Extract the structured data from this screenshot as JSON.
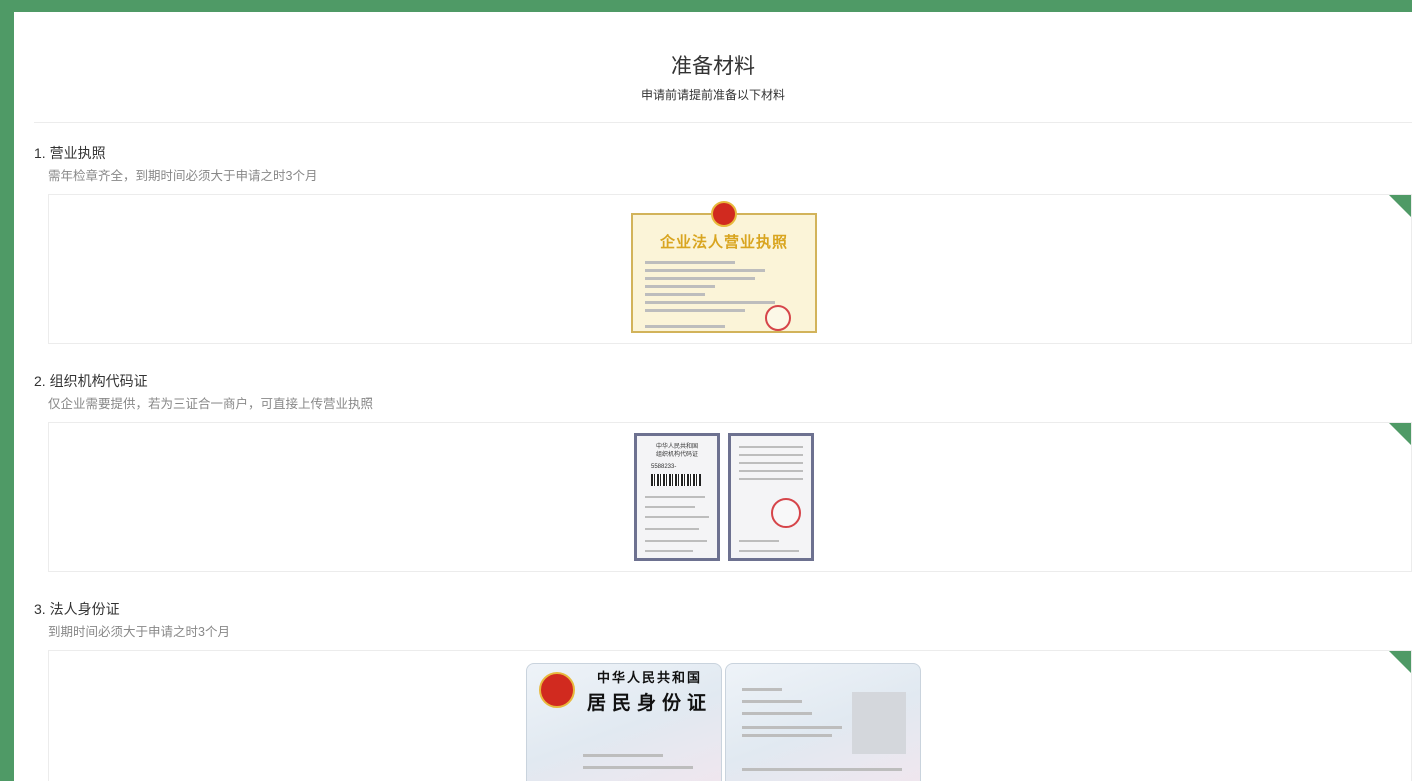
{
  "header": {
    "title": "准备材料",
    "subtitle": "申请前请提前准备以下材料"
  },
  "sections": [
    {
      "title": "1. 营业执照",
      "desc": "需年检章齐全，到期时间必须大于申请之时3个月",
      "image": {
        "title": "企业法人营业执照",
        "icon": "business-license-image"
      }
    },
    {
      "title": "2. 组织机构代码证",
      "desc": "仅企业需要提供，若为三证合一商户，可直接上传营业执照",
      "image": {
        "header_line1": "中华人民共和国",
        "header_line2": "组织机构代码证",
        "code": "5588233-",
        "icon": "organization-code-certificate-image"
      }
    },
    {
      "title": "3. 法人身份证",
      "desc": "到期时间必须大于申请之时3个月",
      "image": {
        "top_text": "中华人民共和国",
        "main_text": "居民身份证",
        "icon": "id-card-image"
      }
    }
  ],
  "colors": {
    "background": "#4f9a66",
    "accent": "#4f9a66",
    "license_title": "#d9a520",
    "seal_red": "#d12a1f"
  }
}
